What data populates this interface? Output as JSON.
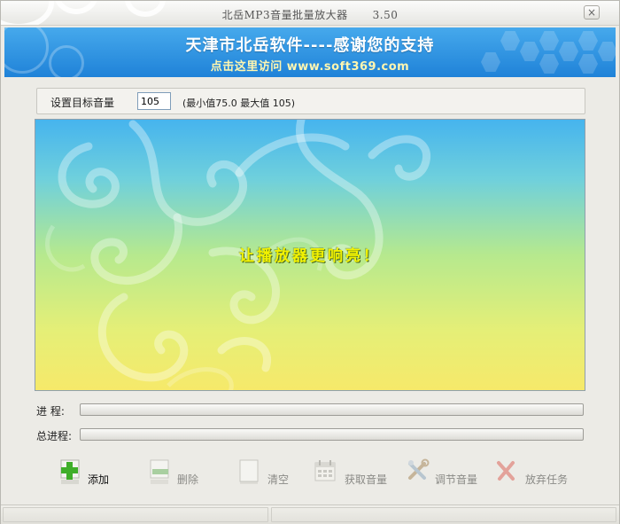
{
  "window": {
    "title": "北岳MP3音量批量放大器",
    "version": "3.50",
    "close_glyph": "×"
  },
  "banner": {
    "line1": "天津市北岳软件----感谢您的支持",
    "line2": "点击这里访问 www.soft369.com"
  },
  "settings": {
    "label": "设置目标音量",
    "value": "105",
    "range_text": "(最小值75.0  最大值 105)"
  },
  "display": {
    "slogan": "让播放器更响亮！"
  },
  "progress": {
    "current_label": "进  程:",
    "current_value": 0,
    "total_label": "总进程:",
    "total_value": 0
  },
  "toolbar": {
    "add": {
      "label": "添加",
      "icon": "add-icon",
      "enabled": true
    },
    "delete": {
      "label": "删除",
      "icon": "remove-icon",
      "enabled": false
    },
    "clear": {
      "label": "清空",
      "icon": "blank-page-icon",
      "enabled": false
    },
    "get_volume": {
      "label": "获取音量",
      "icon": "calendar-icon",
      "enabled": false
    },
    "adjust_volume": {
      "label": "调节音量",
      "icon": "tools-icon",
      "enabled": false
    },
    "abort": {
      "label": "放弃任务",
      "icon": "x-icon",
      "enabled": false
    }
  },
  "colors": {
    "banner_top": "#46a9ec",
    "banner_bottom": "#1f82d8",
    "slogan": "#f2f200",
    "add_green": "#3fae2a"
  }
}
